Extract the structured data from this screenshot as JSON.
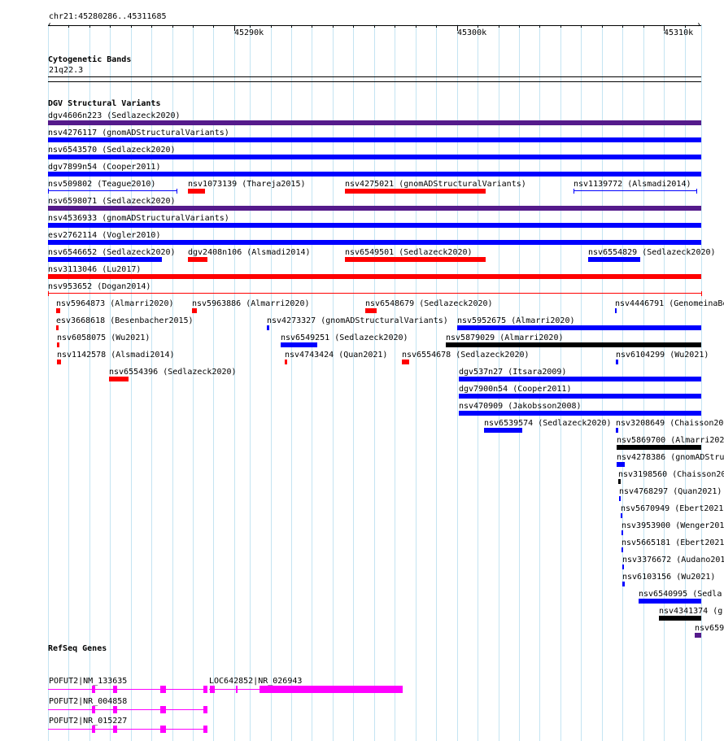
{
  "location": "chr21:45280286..45311685",
  "ruler": {
    "ticks": [
      "45290k",
      "45300k",
      "45310k"
    ]
  },
  "tracks": {
    "cyto": {
      "title": "Cytogenetic Bands",
      "band": "21q22.3"
    },
    "dgv": {
      "title": "DGV Structural Variants"
    },
    "refseq": {
      "title": "RefSeq Genes"
    }
  },
  "colors": {
    "gain": "#0000ff",
    "loss": "#ff0000",
    "both": "#551a8b",
    "inversion": "#000000",
    "gene": "#ff00ff",
    "grid": "#c4e4f2"
  },
  "features": [
    {
      "label": "dgv4606n223 (Sedlazeck2020)",
      "color": "#551a8b"
    },
    {
      "label": "nsv4276117 (gnomADStructuralVariants)",
      "color": "#0000ff"
    },
    {
      "label": "nsv6543570 (Sedlazeck2020)",
      "color": "#0000ff"
    },
    {
      "label": "dgv7899n54 (Cooper2011)",
      "color": "#0000ff"
    },
    {
      "label": "nsv509802 (Teague2010)",
      "color": "#0000ff"
    },
    {
      "label": "nsv1073139 (Thareja2015)",
      "color": "#ff0000"
    },
    {
      "label": "nsv4275021 (gnomADStructuralVariants)",
      "color": "#ff0000"
    },
    {
      "label": "nsv1139772 (Alsmadi2014)",
      "color": "#0000ff"
    },
    {
      "label": "nsv6598071 (Sedlazeck2020)",
      "color": "#551a8b"
    },
    {
      "label": "nsv4536933 (gnomADStructuralVariants)",
      "color": "#0000ff"
    },
    {
      "label": "esv2762114 (Vogler2010)",
      "color": "#0000ff"
    },
    {
      "label": "nsv6546652 (Sedlazeck2020)",
      "color": "#0000ff"
    },
    {
      "label": "dgv2408n106 (Alsmadi2014)",
      "color": "#ff0000"
    },
    {
      "label": "nsv6549501 (Sedlazeck2020)",
      "color": "#ff0000"
    },
    {
      "label": "nsv6554829 (Sedlazeck2020)",
      "color": "#0000ff"
    },
    {
      "label": "nsv3113046 (Lu2017)",
      "color": "#ff0000"
    },
    {
      "label": "nsv953652 (Dogan2014)",
      "color": "#ff0000"
    },
    {
      "label": "nsv5964873 (Almarri2020)",
      "color": "#ff0000"
    },
    {
      "label": "nsv5963886 (Almarri2020)",
      "color": "#ff0000"
    },
    {
      "label": "nsv6548679 (Sedlazeck2020)",
      "color": "#ff0000"
    },
    {
      "label": "nsv4446791 (GenomeinaBottle)",
      "color": "#0000ff"
    },
    {
      "label": "esv3668618 (Besenbacher2015)",
      "color": "#ff0000"
    },
    {
      "label": "nsv4273327 (gnomADStructuralVariants)",
      "color": "#0000ff"
    },
    {
      "label": "nsv5952675 (Almarri2020)",
      "color": "#0000ff"
    },
    {
      "label": "nsv6058075 (Wu2021)",
      "color": "#ff0000"
    },
    {
      "label": "nsv6549251 (Sedlazeck2020)",
      "color": "#0000ff"
    },
    {
      "label": "nsv5879029 (Almarri2020)",
      "color": "#000000"
    },
    {
      "label": "nsv1142578 (Alsmadi2014)",
      "color": "#ff0000"
    },
    {
      "label": "nsv4743424 (Quan2021)",
      "color": "#ff0000"
    },
    {
      "label": "nsv6554678 (Sedlazeck2020)",
      "color": "#ff0000"
    },
    {
      "label": "nsv6104299 (Wu2021)",
      "color": "#0000ff"
    },
    {
      "label": "nsv6554396 (Sedlazeck2020)",
      "color": "#ff0000"
    },
    {
      "label": "dgv537n27 (Itsara2009)",
      "color": "#0000ff"
    },
    {
      "label": "dgv7900n54 (Cooper2011)",
      "color": "#0000ff"
    },
    {
      "label": "nsv470909 (Jakobsson2008)",
      "color": "#0000ff"
    },
    {
      "label": "nsv6539574 (Sedlazeck2020)",
      "color": "#0000ff"
    },
    {
      "label": "nsv3208649 (Chaisson20",
      "color": "#0000ff"
    },
    {
      "label": "nsv5869700 (Almarri202",
      "color": "#000000"
    },
    {
      "label": "nsv4278386 (gnomADStru",
      "color": "#0000ff"
    },
    {
      "label": "nsv3198560 (Chaisson20",
      "color": "#000000"
    },
    {
      "label": "nsv4768297 (Quan2021)",
      "color": "#0000ff"
    },
    {
      "label": "nsv5670949 (Ebert2021",
      "color": "#0000ff"
    },
    {
      "label": "nsv3953900 (Wenger201",
      "color": "#0000ff"
    },
    {
      "label": "nsv5665181 (Ebert2021",
      "color": "#0000ff"
    },
    {
      "label": "nsv3376672 (Audano201",
      "color": "#0000ff"
    },
    {
      "label": "nsv6103156 (Wu2021)",
      "color": "#0000ff"
    },
    {
      "label": "nsv6540995 (Sedla",
      "color": "#0000ff"
    },
    {
      "label": "nsv4341374 (g",
      "color": "#000000"
    },
    {
      "label": "nsv659",
      "color": "#551a8b"
    }
  ],
  "genes": [
    {
      "label": "POFUT2|NM_133635"
    },
    {
      "label": "LOC642852|NR_026943"
    },
    {
      "label": "POFUT2|NR_004858"
    },
    {
      "label": "POFUT2|NR_015227"
    }
  ]
}
